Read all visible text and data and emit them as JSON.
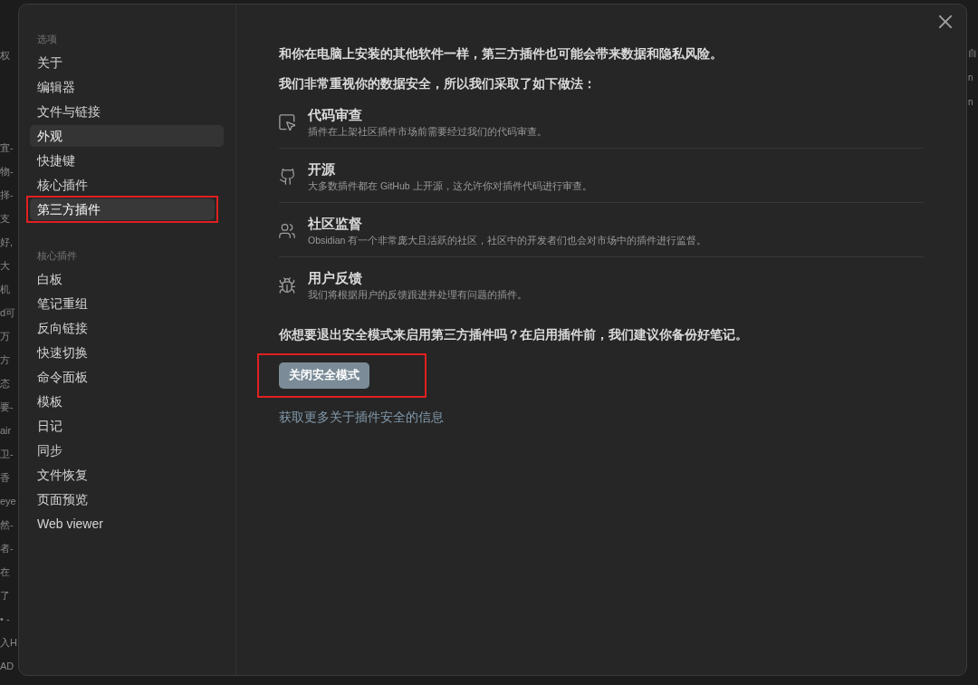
{
  "background_text": {
    "left": [
      "权",
      "宜-",
      "物-",
      "择-",
      "支",
      "好,",
      "大",
      "机",
      "d可",
      "万",
      "方",
      "态",
      "要-",
      "air",
      "卫-",
      "香",
      "eye",
      "然-",
      "者-",
      "在",
      "了",
      "• -",
      "入H",
      "AD"
    ],
    "right": [
      "自",
      "n",
      "n"
    ]
  },
  "settings": {
    "sidebar": [
      {
        "heading": "选项",
        "items": [
          {
            "label": "关于",
            "selected": false,
            "hovered": false,
            "annotated": false
          },
          {
            "label": "编辑器",
            "selected": false,
            "hovered": false,
            "annotated": false
          },
          {
            "label": "文件与链接",
            "selected": false,
            "hovered": false,
            "annotated": false
          },
          {
            "label": "外观",
            "selected": false,
            "hovered": true,
            "annotated": false
          },
          {
            "label": "快捷键",
            "selected": false,
            "hovered": false,
            "annotated": false
          },
          {
            "label": "核心插件",
            "selected": false,
            "hovered": false,
            "annotated": false
          },
          {
            "label": "第三方插件",
            "selected": true,
            "hovered": false,
            "annotated": true
          }
        ]
      },
      {
        "heading": "核心插件",
        "items": [
          {
            "label": "白板",
            "selected": false,
            "hovered": false,
            "annotated": false
          },
          {
            "label": "笔记重组",
            "selected": false,
            "hovered": false,
            "annotated": false
          },
          {
            "label": "反向链接",
            "selected": false,
            "hovered": false,
            "annotated": false
          },
          {
            "label": "快速切换",
            "selected": false,
            "hovered": false,
            "annotated": false
          },
          {
            "label": "命令面板",
            "selected": false,
            "hovered": false,
            "annotated": false
          },
          {
            "label": "模板",
            "selected": false,
            "hovered": false,
            "annotated": false
          },
          {
            "label": "日记",
            "selected": false,
            "hovered": false,
            "annotated": false
          },
          {
            "label": "同步",
            "selected": false,
            "hovered": false,
            "annotated": false
          },
          {
            "label": "文件恢复",
            "selected": false,
            "hovered": false,
            "annotated": false
          },
          {
            "label": "页面预览",
            "selected": false,
            "hovered": false,
            "annotated": false
          },
          {
            "label": "Web viewer",
            "selected": false,
            "hovered": false,
            "annotated": false
          }
        ]
      }
    ],
    "content": {
      "intro": "和你在电脑上安装的其他软件一样，第三方插件也可能会带来数据和隐私风险。",
      "measures_heading": "我们非常重视你的数据安全，所以我们采取了如下做法：",
      "measures": [
        {
          "kind": "review",
          "title": "代码审查",
          "description": "插件在上架社区插件市场前需要经过我们的代码审查。"
        },
        {
          "kind": "open-source",
          "title": "开源",
          "description": "大多数插件都在 GitHub 上开源，这允许你对插件代码进行审查。"
        },
        {
          "kind": "community",
          "title": "社区监督",
          "description": "Obsidian 有一个非常庞大且活跃的社区，社区中的开发者们也会对市场中的插件进行监督。"
        },
        {
          "kind": "feedback",
          "title": "用户反馈",
          "description": "我们将根据用户的反馈跟进并处理有问题的插件。"
        }
      ],
      "question": "你想要退出安全模式来启用第三方插件吗？在启用插件前，我们建议你备份好笔记。",
      "button": {
        "label": "关闭安全模式",
        "annotated": true
      },
      "link": "获取更多关于插件安全的信息"
    }
  }
}
